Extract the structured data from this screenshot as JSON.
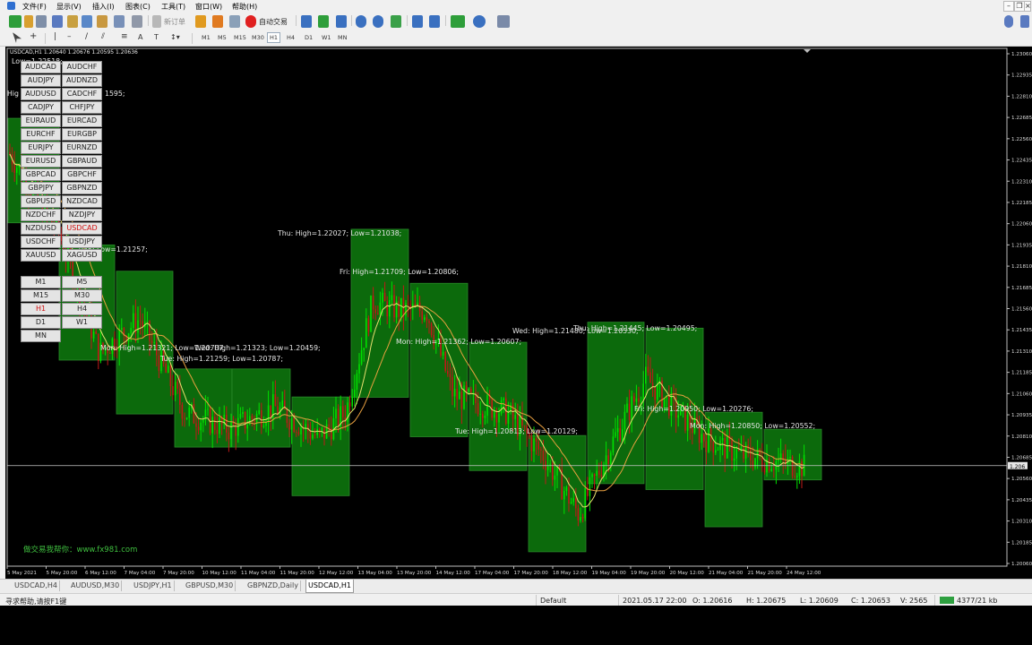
{
  "menu": [
    "文件(F)",
    "显示(V)",
    "插入(I)",
    "图表(C)",
    "工具(T)",
    "窗口(W)",
    "帮助(H)"
  ],
  "toolbar": {
    "new_order": "新订单",
    "autotrade": "自动交易"
  },
  "timeframe_toolbar": [
    "M1",
    "M5",
    "M15",
    "M30",
    "H1",
    "H4",
    "D1",
    "W1",
    "MN"
  ],
  "chart": {
    "info_line": "USDCAD,H1  1.20640 1.20676 1.20595 1.20636",
    "current_price": "1.206",
    "price_labels": [
      "1.23060",
      "1.22935",
      "1.22810",
      "1.22685",
      "1.22560",
      "1.22435",
      "1.22310",
      "1.22185",
      "1.22060",
      "1.21935",
      "1.21810",
      "1.21685",
      "1.21560",
      "1.21435",
      "1.21310",
      "1.21185",
      "1.21060",
      "1.20935",
      "1.20810",
      "1.20685",
      "1.20560",
      "1.20435",
      "1.20310",
      "1.20185",
      "1.20060"
    ],
    "time_labels": [
      "5 May 2021",
      "5 May 20:00",
      "6 May 12:00",
      "7 May 04:00",
      "7 May 20:00",
      "10 May 12:00",
      "11 May 04:00",
      "11 May 20:00",
      "12 May 12:00",
      "13 May 04:00",
      "13 May 20:00",
      "14 May 12:00",
      "17 May 04:00",
      "17 May 20:00",
      "18 May 12:00",
      "19 May 04:00",
      "19 May 20:00",
      "20 May 12:00",
      "21 May 04:00",
      "21 May 20:00",
      "24 May 12:00"
    ],
    "watermark": "做交易我帮你：www.fx981.com",
    "annotations": [
      "Low=1.22518;",
      "Hig",
      "1595;",
      "935;  Low=1.21257;",
      "Thu:  High=1.22027;  Low=1.21038;",
      "Fri:  High=1.21709;  Low=1.20806;",
      "Mon:  High=1.21321;  Low=1.20707;",
      "Wed:  High=1.21323;  Low=1.20459;",
      "Tue:  High=1.21259;  Low=1.20787;",
      "Mon:  High=1.21362;  Low=1.20607;",
      "Wed:  High=1.21480;  Low=1.20530;",
      "Thu:  High=1.21445;  Low=1.20495;",
      "Tue:  High=1.20813;  Low=1.20129;",
      "Fri:  High=1.20950;  Low=1.20276;",
      "Mon:  High=1.20850;  Low=1.20552;"
    ]
  },
  "symbols": [
    "AUDCAD",
    "AUDCHF",
    "AUDJPY",
    "AUDNZD",
    "AUDUSD",
    "CADCHF",
    "CADJPY",
    "CHFJPY",
    "EURAUD",
    "EURCAD",
    "EURCHF",
    "EURGBP",
    "EURJPY",
    "EURNZD",
    "EURUSD",
    "GBPAUD",
    "GBPCAD",
    "GBPCHF",
    "GBPJPY",
    "GBPNZD",
    "GBPUSD",
    "NZDCAD",
    "NZDCHF",
    "NZDJPY",
    "NZDUSD",
    "USDCAD",
    "USDCHF",
    "USDJPY",
    "XAUUSD",
    "XAGUSD"
  ],
  "active_symbol": "USDCAD",
  "tf_buttons": [
    "M1",
    "M5",
    "M15",
    "M30",
    "H1",
    "H4",
    "D1",
    "W1",
    "MN"
  ],
  "active_tf": "H1",
  "tabs": [
    "USDCAD,H4",
    "AUDUSD,M30",
    "USDJPY,H1",
    "GBPUSD,M30",
    "GBPNZD,Daily",
    "USDCAD,H1"
  ],
  "active_tab": "USDCAD,H1",
  "status": {
    "help": "寻求帮助,请按F1键",
    "profile": "Default",
    "datetime": "2021.05.17 22:00",
    "open": "O: 1.20616",
    "high": "H: 1.20675",
    "low": "L: 1.20609",
    "close": "C: 1.20653",
    "volume": "V: 2565",
    "traffic": "4377/21 kb"
  },
  "colors": {
    "box_fill": "#0c6a0c",
    "bull": "#00e000",
    "bear": "#c01818",
    "ma_fast": "#e8e070",
    "ma_slow": "#e8a040"
  }
}
